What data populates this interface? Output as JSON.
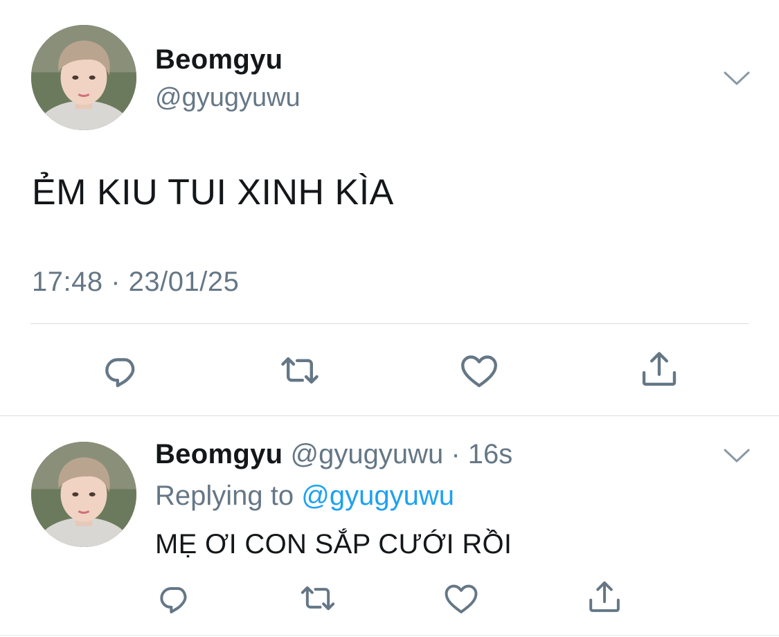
{
  "main_tweet": {
    "display_name": "Beomgyu",
    "handle": "@gyugyuwu",
    "text": "ẺM KIU TUI XINH KÌA",
    "timestamp": "17:48 · 23/01/25",
    "menu_icon": "chevron-down-icon",
    "actions": [
      {
        "name": "reply",
        "icon": "reply-icon"
      },
      {
        "name": "retweet",
        "icon": "retweet-icon"
      },
      {
        "name": "like",
        "icon": "heart-icon"
      },
      {
        "name": "share",
        "icon": "share-icon"
      }
    ]
  },
  "reply_tweet": {
    "display_name": "Beomgyu",
    "handle": "@gyugyuwu",
    "separator": "·",
    "time_ago": "16s",
    "replying_label": "Replying to",
    "replying_handle": "@gyugyuwu",
    "text": "MẸ ƠI CON SẮP CƯỚI RỒI",
    "menu_icon": "chevron-down-icon",
    "actions": [
      {
        "name": "reply",
        "icon": "reply-icon"
      },
      {
        "name": "retweet",
        "icon": "retweet-icon"
      },
      {
        "name": "like",
        "icon": "heart-icon"
      },
      {
        "name": "share",
        "icon": "share-icon"
      }
    ]
  },
  "colors": {
    "text_primary": "#14171a",
    "text_secondary": "#657786",
    "link": "#1da1f2",
    "icon": "#657786",
    "divider": "#d8dee3"
  }
}
